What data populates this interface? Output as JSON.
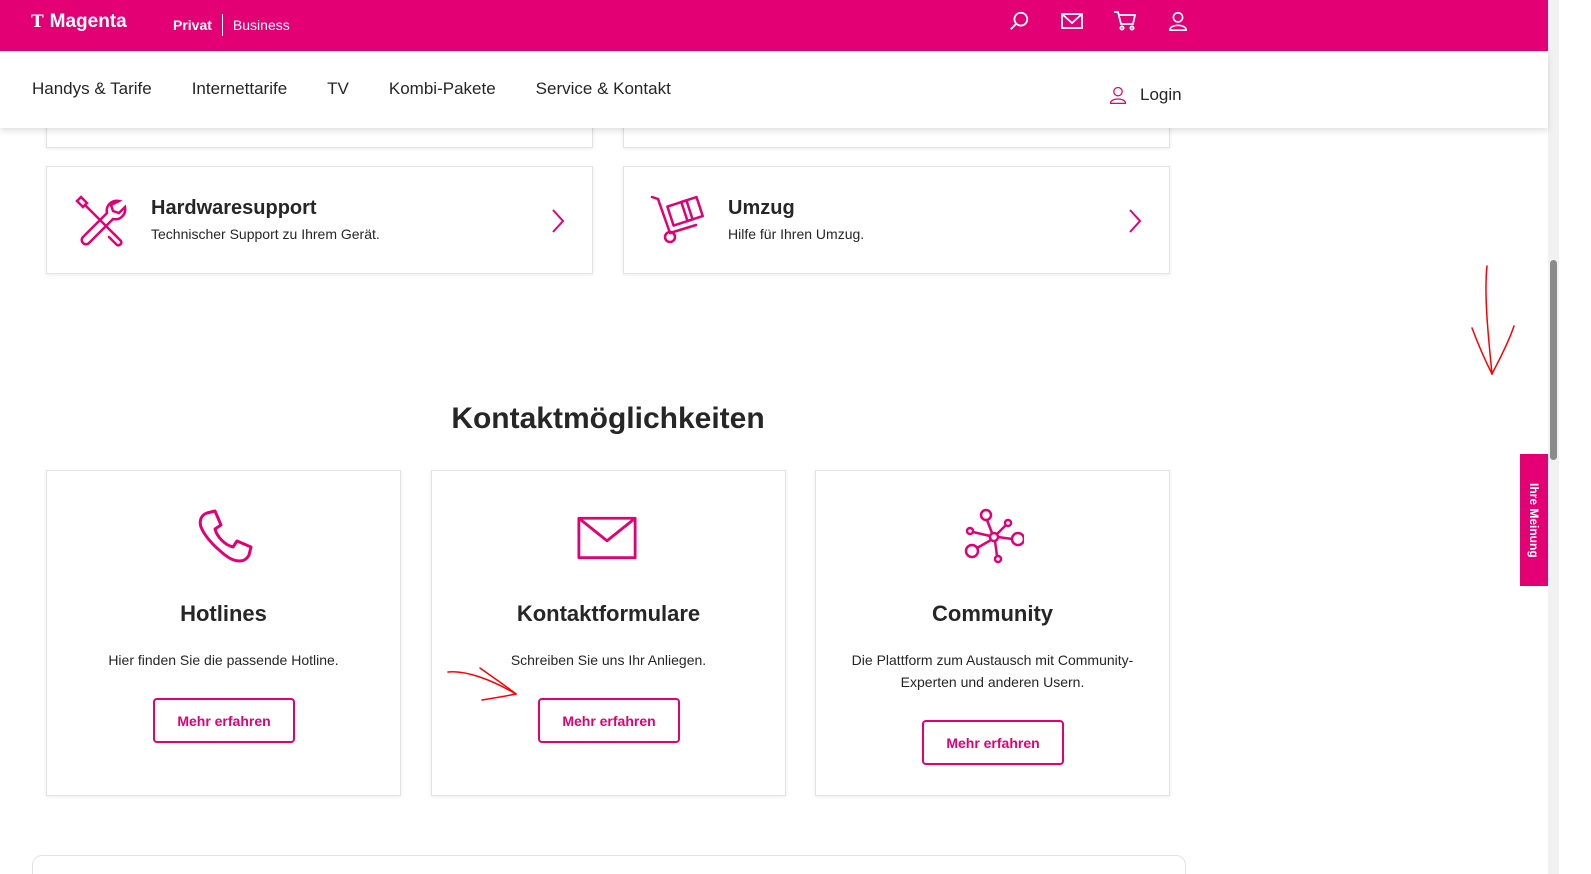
{
  "header": {
    "brand_letter": "T",
    "brand_name": "Magenta",
    "segment_private": "Privat",
    "segment_business": "Business",
    "icons": [
      "search-icon",
      "mail-icon",
      "cart-icon",
      "user-icon"
    ]
  },
  "nav": {
    "items": [
      {
        "label": "Handys & Tarife"
      },
      {
        "label": "Internettarife"
      },
      {
        "label": "TV"
      },
      {
        "label": "Kombi-Pakete"
      },
      {
        "label": "Service & Kontakt"
      }
    ],
    "login_label": "Login"
  },
  "service_cards": [
    {
      "title": "Hardwaresupport",
      "subtitle": "Technischer Support zu Ihrem Gerät.",
      "icon": "tools-icon"
    },
    {
      "title": "Umzug",
      "subtitle": "Hilfe für Ihren Umzug.",
      "icon": "hand-truck-icon"
    }
  ],
  "contact": {
    "heading": "Kontaktmöglichkeiten",
    "cards": [
      {
        "title": "Hotlines",
        "text": "Hier finden Sie die passende Hotline.",
        "button": "Mehr erfahren",
        "icon": "phone-icon"
      },
      {
        "title": "Kontaktformulare",
        "text": "Schreiben Sie uns Ihr Anliegen.",
        "button": "Mehr erfahren",
        "icon": "envelope-icon"
      },
      {
        "title": "Community",
        "text": "Die Plattform zum Austausch mit Community-Experten und anderen Usern.",
        "button": "Mehr erfahren",
        "icon": "network-icon"
      }
    ]
  },
  "feedback_tab": "Ihre Meinung",
  "colors": {
    "brand": "#e20074",
    "text": "#262626",
    "annotation": "#ff0000"
  }
}
